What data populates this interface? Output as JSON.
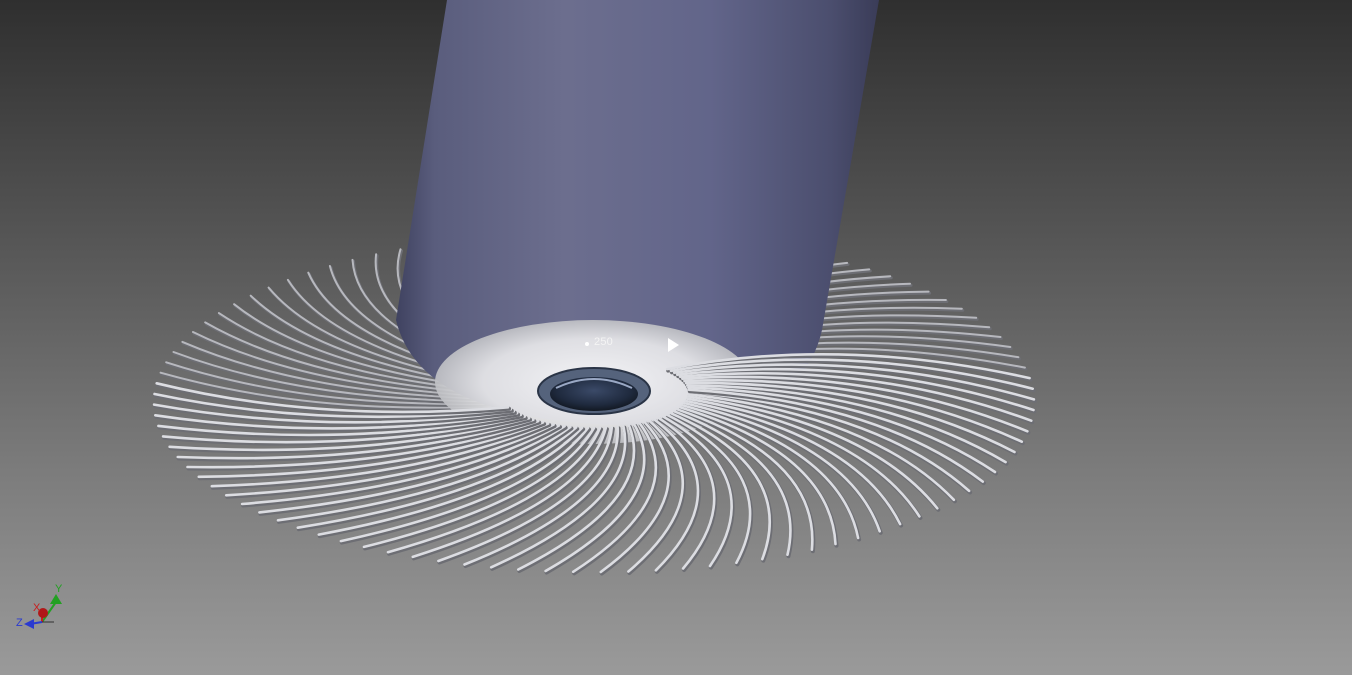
{
  "viewport": {
    "background_top": "#2f2f2f",
    "background_bottom": "#9a9a9a"
  },
  "model": {
    "cylinder_color": "#686a8a",
    "blade_color": "#dcdde2",
    "blade_count": 100,
    "hub_color": "#2e3b54"
  },
  "dimension": {
    "value": "250"
  },
  "triad": {
    "x_label": "X",
    "y_label": "Y",
    "z_label": "Z",
    "x_color": "#c81e1e",
    "y_color": "#22a022",
    "z_color": "#2a3ad0"
  }
}
